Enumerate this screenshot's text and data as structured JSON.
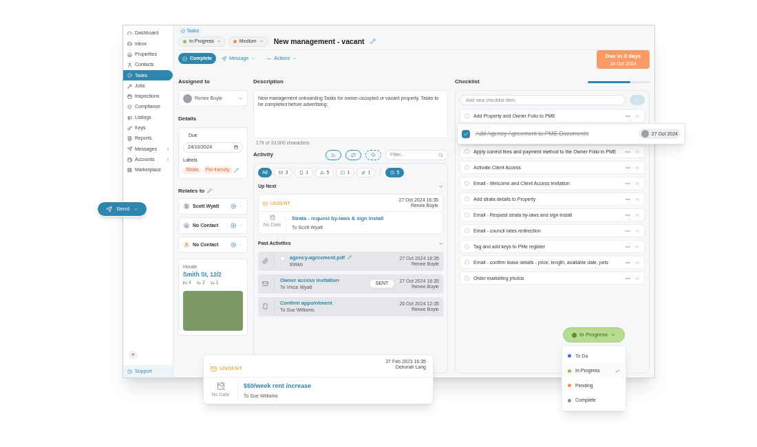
{
  "sidebar": {
    "items": [
      {
        "label": "Dashboard",
        "selected": false,
        "submenu": false
      },
      {
        "label": "Inbox",
        "selected": false,
        "submenu": false
      },
      {
        "label": "Properties",
        "selected": false,
        "submenu": false
      },
      {
        "label": "Contacts",
        "selected": false,
        "submenu": false
      },
      {
        "label": "Tasks",
        "selected": true,
        "submenu": false
      },
      {
        "label": "Jobs",
        "selected": false,
        "submenu": false
      },
      {
        "label": "Inspections",
        "selected": false,
        "submenu": false
      },
      {
        "label": "Compliance",
        "selected": false,
        "submenu": false
      },
      {
        "label": "Listings",
        "selected": false,
        "submenu": false
      },
      {
        "label": "Keys",
        "selected": false,
        "submenu": false
      },
      {
        "label": "Reports",
        "selected": false,
        "submenu": false
      },
      {
        "label": "Messages",
        "selected": false,
        "submenu": true
      },
      {
        "label": "Accounts",
        "selected": false,
        "submenu": true
      },
      {
        "label": "Marketplace",
        "selected": false,
        "submenu": false
      }
    ],
    "collapse": "«",
    "support": "Support"
  },
  "header": {
    "breadcrumb": "Tasks",
    "status": {
      "label": "In Progress",
      "color": "#8cc152"
    },
    "priority": {
      "label": "Medium",
      "color": "#fb8c4e"
    },
    "title": "New management - vacant",
    "complete": "Complete",
    "message": "Message",
    "actions": "Actions",
    "due": {
      "label": "Due in 3 days",
      "date": "24 Oct 2024"
    }
  },
  "assigned": {
    "title": "Assigned to",
    "name": "Renee Boyle"
  },
  "details": {
    "title": "Details",
    "due_label": "Due",
    "due_value": "24/10/2024",
    "labels_title": "Labels",
    "labels": [
      "Strata",
      "Pet friendly"
    ]
  },
  "relates": {
    "title": "Relates to",
    "items": [
      {
        "kind": "building",
        "name": "Scott Wyatt"
      },
      {
        "kind": "house",
        "name": "No Contact"
      },
      {
        "kind": "person",
        "name": "No Contact"
      }
    ]
  },
  "property": {
    "type": "House",
    "address": "Smith St, 12/2",
    "beds": "4",
    "baths": "2",
    "cars": "1"
  },
  "description": {
    "title": "Description",
    "text": "New management onboarding Tasks for owner-occupied or vacant property. Tasks to be completed before advertising.",
    "counter": "179 of 10,000 characters"
  },
  "activity": {
    "title": "Activity",
    "filter_placeholder": "Filter...",
    "chips": [
      {
        "kind": "all",
        "label": "All",
        "selected": true
      },
      {
        "kind": "email",
        "label": "3",
        "selected": false
      },
      {
        "kind": "phone",
        "label": "1",
        "selected": false
      },
      {
        "kind": "webhook",
        "label": "5",
        "selected": false
      },
      {
        "kind": "chat",
        "label": "1",
        "selected": false
      },
      {
        "kind": "attachment",
        "label": "1",
        "selected": false
      },
      {
        "kind": "history",
        "label": "5",
        "selected": true
      }
    ],
    "up_next": {
      "title": "Up Next",
      "items": [
        {
          "status": "UNSENT",
          "date": "27 Oct 2024 16:35",
          "author": "Renee Boyle",
          "no_date": "No Date",
          "title": "Strata - request by-laws & sign install",
          "to": "To Scott Wyatt"
        }
      ]
    },
    "past": {
      "title": "Past Activities",
      "items": [
        {
          "kind": "attachment",
          "checked": false,
          "title": "agency-agreement.pdf",
          "subtitle": "899kb",
          "date": "27 Oct 2024 16:35",
          "author": "Renee Boyle"
        },
        {
          "kind": "email",
          "title": "Owner access invitation",
          "subtitle": "To Vince Wyatt",
          "badge": "SENT",
          "date": "27 Oct 2024 16:35",
          "author": "Renee Boyle"
        },
        {
          "kind": "phone",
          "title": "Confirm appointment",
          "subtitle": "To Sue Williams",
          "date": "26 Oct 2024 12:35",
          "author": "Renee Boyle"
        }
      ]
    }
  },
  "checklist": {
    "title": "Checklist",
    "level": 0.69,
    "placeholder": "Add new checklist item",
    "items": [
      {
        "text": "Add Property and Owner Folio to PME",
        "checked": false,
        "dragging": false
      },
      {
        "text": "Add Agency Agreement to PME Documents",
        "checked": true,
        "dragging": true,
        "date": "27 Oct 2024"
      },
      {
        "text": "Apply correct fees and payment method to the Owner Folio in PME",
        "checked": false,
        "dragging": false
      },
      {
        "text": "Activate Client Access",
        "checked": false,
        "dragging": false
      },
      {
        "text": "Email - Welcome and Client Access invitation",
        "checked": false,
        "dragging": false
      },
      {
        "text": "Add strata details to Property",
        "checked": false,
        "dragging": false
      },
      {
        "text": "Email - Request strata by-laws and sign install",
        "checked": false,
        "dragging": false
      },
      {
        "text": "Email - council rates redirection",
        "checked": false,
        "dragging": false
      },
      {
        "text": "Tag and add keys to PMe register",
        "checked": false,
        "dragging": false
      },
      {
        "text": "Email - confirm lease details - price, length, available date, pets",
        "checked": false,
        "dragging": false
      },
      {
        "text": "Order marketing photos",
        "checked": false,
        "dragging": false
      }
    ]
  },
  "send_button": "Send",
  "floating_card": {
    "status": "UNSENT",
    "date": "27 Feb 2023 16:35",
    "author": "Deborah Lang",
    "no_date": "No Date",
    "title": "$50/week rent increase",
    "to": "To Sue Williams"
  },
  "status_menu": {
    "current": {
      "label": "In Progress",
      "color": "#5f8a3a"
    },
    "options": [
      {
        "label": "To Do",
        "color": "#3b6fe0",
        "selected": false
      },
      {
        "label": "In Progress",
        "color": "#8cc152",
        "selected": true
      },
      {
        "label": "Pending",
        "color": "#fb8c4e",
        "selected": false
      },
      {
        "label": "Complete",
        "color": "#8a94a6",
        "selected": false
      }
    ]
  }
}
